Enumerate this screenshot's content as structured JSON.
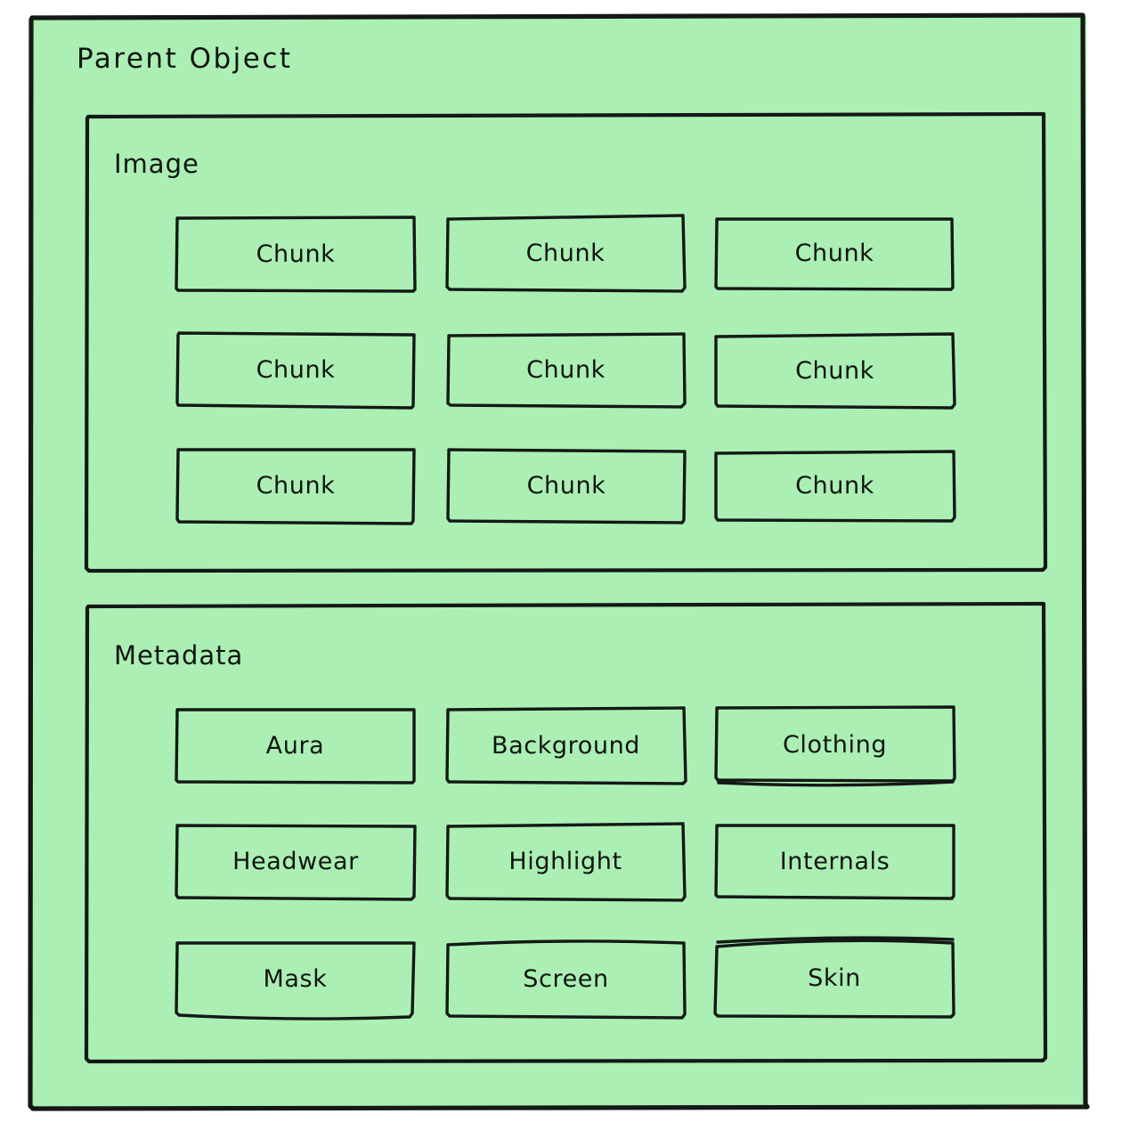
{
  "diagram": {
    "type": "nested-container-diagram",
    "background_color": "#ffffff",
    "fill_color": "#ABEFB4",
    "stroke_color": "#141915",
    "style": "hand-drawn",
    "root": {
      "label": "Parent Object"
    },
    "containers": [
      {
        "id": "image",
        "label": "Image",
        "columns": 3,
        "rows": 3,
        "nodes": [
          {
            "label": "Chunk"
          },
          {
            "label": "Chunk"
          },
          {
            "label": "Chunk"
          },
          {
            "label": "Chunk"
          },
          {
            "label": "Chunk"
          },
          {
            "label": "Chunk"
          },
          {
            "label": "Chunk"
          },
          {
            "label": "Chunk"
          },
          {
            "label": "Chunk"
          }
        ]
      },
      {
        "id": "metadata",
        "label": "Metadata",
        "columns": 3,
        "rows": 3,
        "nodes": [
          {
            "label": "Aura"
          },
          {
            "label": "Background"
          },
          {
            "label": "Clothing"
          },
          {
            "label": "Headwear"
          },
          {
            "label": "Highlight"
          },
          {
            "label": "Internals"
          },
          {
            "label": "Mask"
          },
          {
            "label": "Screen"
          },
          {
            "label": "Skin"
          }
        ]
      }
    ]
  }
}
